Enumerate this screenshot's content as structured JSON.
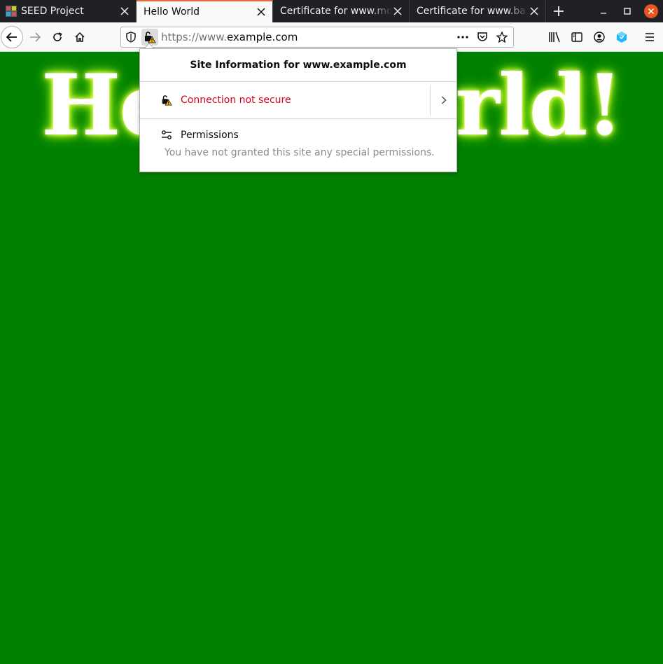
{
  "tabs": [
    {
      "title": "SEED Project",
      "icon": "seed-favicon",
      "active": false
    },
    {
      "title": "Hello World",
      "icon": "",
      "active": true
    },
    {
      "title": "Certificate for www.mo",
      "icon": "",
      "active": false
    },
    {
      "title": "Certificate for www.ba",
      "icon": "",
      "active": false
    }
  ],
  "url": {
    "prefix": "https://www.",
    "host": "example.com"
  },
  "page": {
    "heading": "Hello World!"
  },
  "site_info": {
    "title": "Site Information for www.example.com",
    "connection": "Connection not secure",
    "permissions_label": "Permissions",
    "permissions_desc": "You have not granted this site any special permissions."
  },
  "colors": {
    "page_bg": "#008000",
    "tab_accent": "#e66a3a",
    "insecure_red": "#d70022"
  }
}
